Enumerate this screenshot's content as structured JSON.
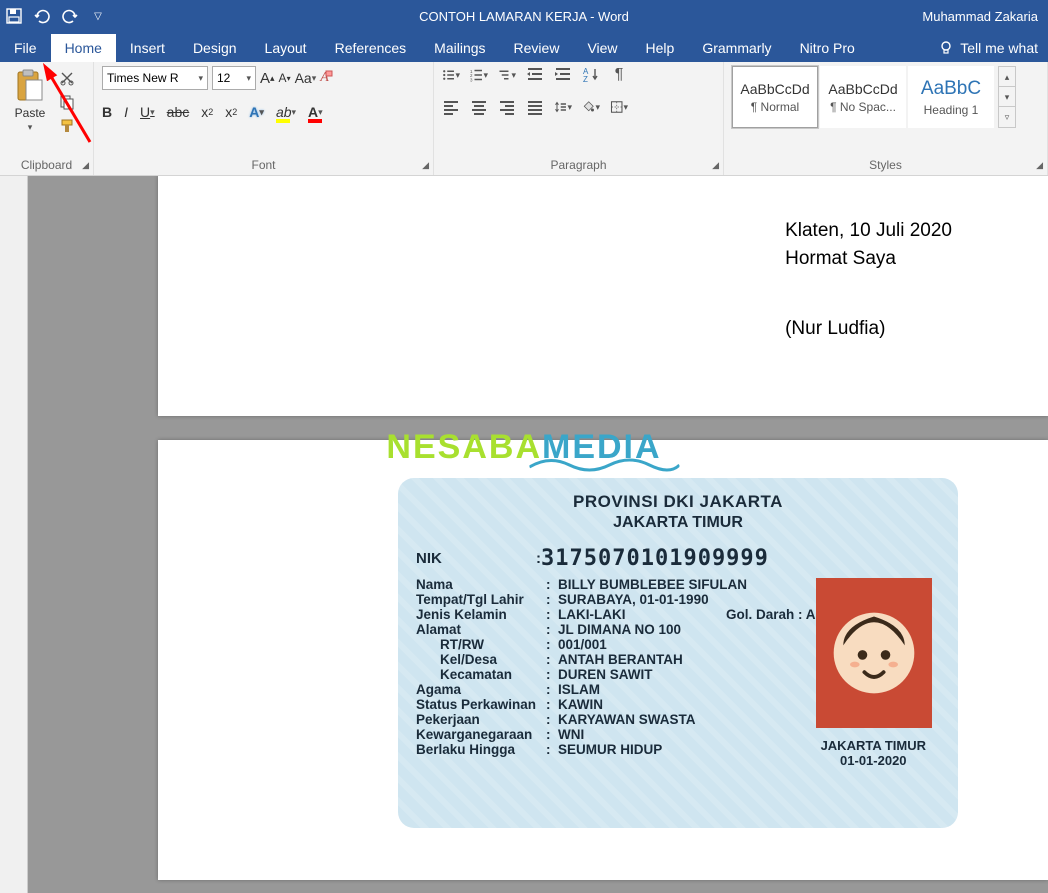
{
  "titlebar": {
    "doc_title": "CONTOH LAMARAN KERJA",
    "app_suffix": "  -  Word",
    "user": "Muhammad Zakaria"
  },
  "tabs": {
    "file": "File",
    "home": "Home",
    "insert": "Insert",
    "design": "Design",
    "layout": "Layout",
    "references": "References",
    "mailings": "Mailings",
    "review": "Review",
    "view": "View",
    "help": "Help",
    "grammarly": "Grammarly",
    "nitro": "Nitro Pro",
    "tellme": "Tell me what"
  },
  "ribbon": {
    "clipboard": {
      "paste": "Paste",
      "label": "Clipboard"
    },
    "font": {
      "name": "Times New R",
      "size": "12",
      "increase": "A",
      "decrease": "A",
      "case": "Aa",
      "clear_glyph": "A",
      "bold": "B",
      "italic": "I",
      "underline": "U",
      "strike": "abc",
      "sub": "x",
      "sup": "x",
      "texteffects": "A",
      "highlight": "ab",
      "color": "A",
      "label": "Font"
    },
    "paragraph": {
      "label": "Paragraph"
    },
    "styles": {
      "label": "Styles",
      "items": [
        {
          "preview": "AaBbCcDd",
          "name": "¶ Normal",
          "sel": true,
          "cls": ""
        },
        {
          "preview": "AaBbCcDd",
          "name": "¶ No Spac...",
          "sel": false,
          "cls": ""
        },
        {
          "preview": "AaBbC",
          "name": "Heading 1",
          "sel": false,
          "cls": "h1"
        }
      ]
    }
  },
  "document": {
    "page1": {
      "date_line": "Klaten, 10 Juli 2020",
      "greeting": "Hormat Saya",
      "signature": "(Nur Ludfia)"
    },
    "idcard": {
      "province": "PROVINSI DKI JAKARTA",
      "city": "JAKARTA TIMUR",
      "nik_label": "NIK",
      "nik_value": "3175070101909999",
      "rows": [
        {
          "lbl": "Nama",
          "val": "BILLY BUMBLEBEE SIFULAN"
        },
        {
          "lbl": "Tempat/Tgl Lahir",
          "val": "SURABAYA, 01-01-1990"
        },
        {
          "lbl": "Jenis Kelamin",
          "val": "LAKI-LAKI",
          "extra_lbl": "Gol. Darah :",
          "extra_val": "AB"
        },
        {
          "lbl": "Alamat",
          "val": "JL DIMANA NO 100"
        },
        {
          "lbl": "RT/RW",
          "val": "001/001",
          "sub": true
        },
        {
          "lbl": "Kel/Desa",
          "val": "ANTAH BERANTAH",
          "sub": true
        },
        {
          "lbl": "Kecamatan",
          "val": "DUREN SAWIT",
          "sub": true
        },
        {
          "lbl": "Agama",
          "val": "ISLAM"
        },
        {
          "lbl": "Status Perkawinan",
          "val": "KAWIN"
        },
        {
          "lbl": "Pekerjaan",
          "val": "KARYAWAN SWASTA"
        },
        {
          "lbl": "Kewarganegaraan",
          "val": "WNI"
        },
        {
          "lbl": "Berlaku Hingga",
          "val": "SEUMUR HIDUP"
        }
      ],
      "issue_city": "JAKARTA TIMUR",
      "issue_date": "01-01-2020"
    }
  },
  "watermark": {
    "a": "NESABA",
    "b": "MEDIA"
  }
}
